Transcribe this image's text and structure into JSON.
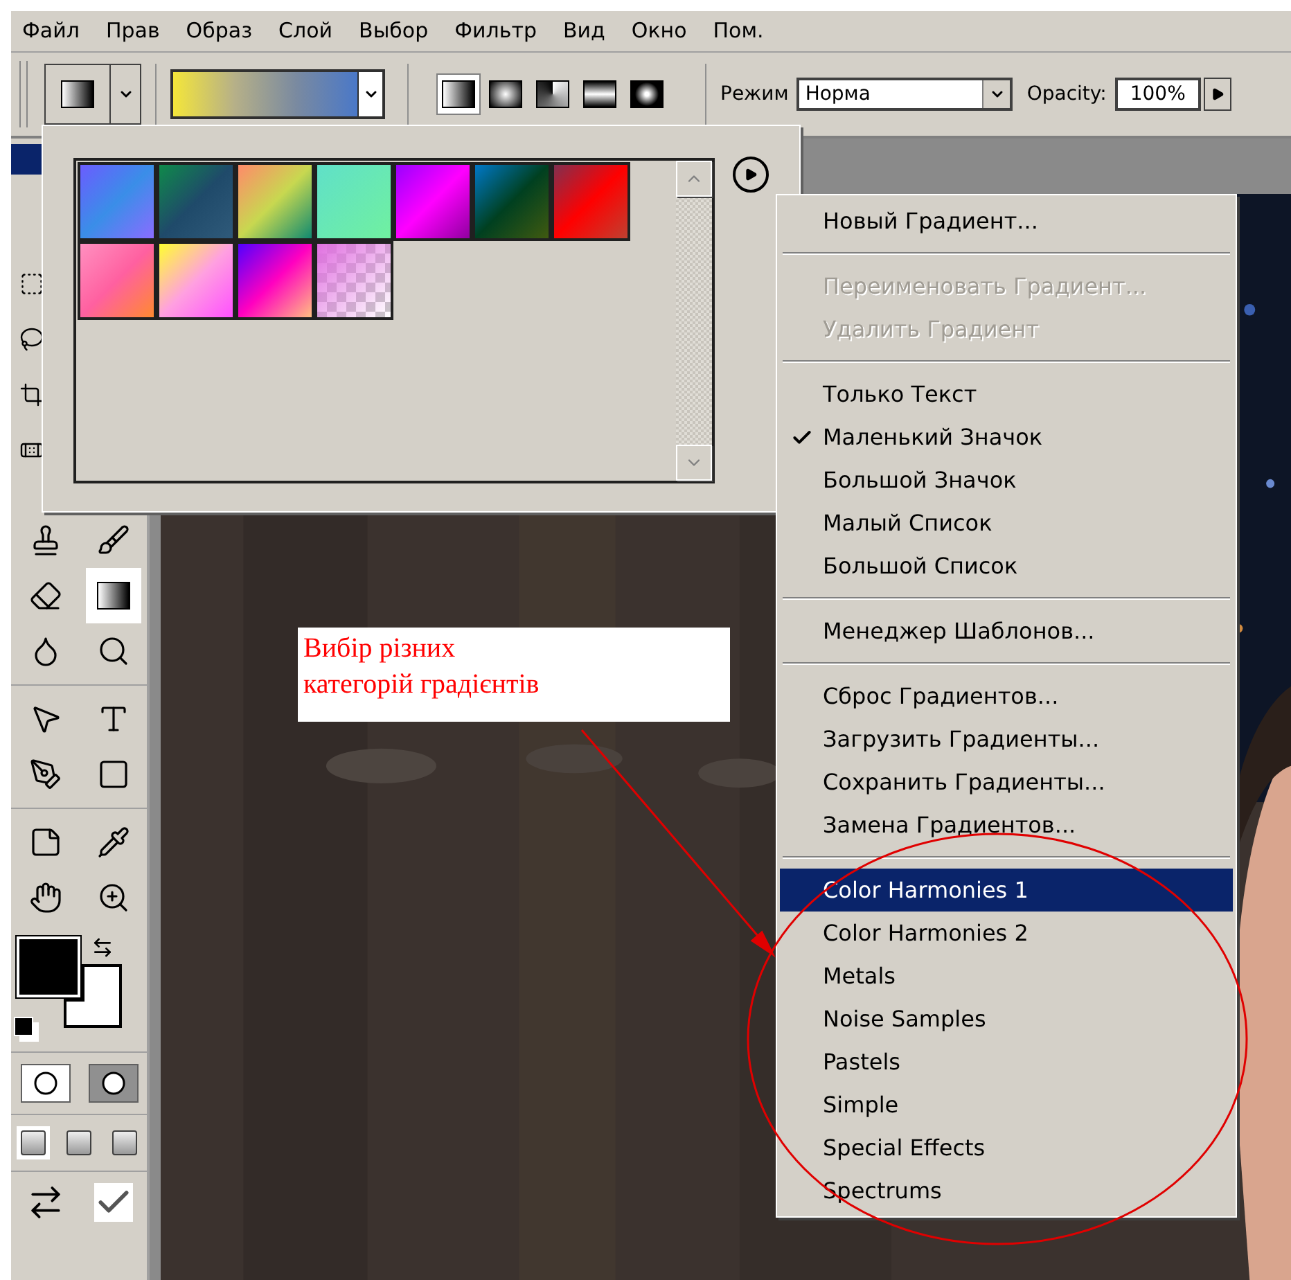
{
  "menu_bar": [
    "Файл",
    "Прав",
    "Образ",
    "Слой",
    "Выбор",
    "Фильтр",
    "Вид",
    "Окно",
    "Пом."
  ],
  "options_bar": {
    "gradient_types": [
      {
        "selected": true
      },
      {
        "selected": false
      },
      {
        "selected": false
      },
      {
        "selected": false
      },
      {
        "selected": false
      }
    ],
    "mode_label": "Режим",
    "mode_value": "Норма",
    "opacity_label": "Opacity:",
    "opacity_value": "100%"
  },
  "toolbox": {
    "tools": [
      {
        "selected": false
      },
      {
        "selected": false
      },
      {
        "selected": false
      },
      {
        "selected": true
      },
      {
        "selected": false
      },
      {
        "selected": false
      },
      {
        "selected": false
      },
      {
        "selected": false
      },
      {
        "selected": false
      },
      {
        "selected": false
      },
      {
        "selected": false
      },
      {
        "selected": false
      },
      {
        "selected": false
      },
      {
        "selected": false
      }
    ],
    "mask_modes": [
      {
        "selected": true
      },
      {
        "selected": false
      }
    ],
    "screen_modes": [
      {
        "selected": true
      },
      {
        "selected": false
      },
      {
        "selected": false
      }
    ]
  },
  "flyout_menu": {
    "items": [
      {
        "kind": "item",
        "label": "Новый Градиент...",
        "disabled": false,
        "checked": false,
        "selected": false
      },
      {
        "kind": "separator"
      },
      {
        "kind": "item",
        "label": "Переименовать Градиент...",
        "disabled": true,
        "checked": false,
        "selected": false
      },
      {
        "kind": "item",
        "label": "Удалить Градиент",
        "disabled": true,
        "checked": false,
        "selected": false
      },
      {
        "kind": "separator"
      },
      {
        "kind": "item",
        "label": "Только Текст",
        "disabled": false,
        "checked": false,
        "selected": false
      },
      {
        "kind": "item",
        "label": "Маленький Значок",
        "disabled": false,
        "checked": true,
        "selected": false
      },
      {
        "kind": "item",
        "label": "Большой Значок",
        "disabled": false,
        "checked": false,
        "selected": false
      },
      {
        "kind": "item",
        "label": "Малый Список",
        "disabled": false,
        "checked": false,
        "selected": false
      },
      {
        "kind": "item",
        "label": "Большой Список",
        "disabled": false,
        "checked": false,
        "selected": false
      },
      {
        "kind": "separator"
      },
      {
        "kind": "item",
        "label": "Менеджер Шаблонов...",
        "disabled": false,
        "checked": false,
        "selected": false
      },
      {
        "kind": "separator"
      },
      {
        "kind": "item",
        "label": "Сброс Градиентов...",
        "disabled": false,
        "checked": false,
        "selected": false
      },
      {
        "kind": "item",
        "label": "Загрузить Градиенты...",
        "disabled": false,
        "checked": false,
        "selected": false
      },
      {
        "kind": "item",
        "label": "Сохранить Градиенты...",
        "disabled": false,
        "checked": false,
        "selected": false
      },
      {
        "kind": "item",
        "label": "Замена Градиентов...",
        "disabled": false,
        "checked": false,
        "selected": false
      },
      {
        "kind": "separator"
      },
      {
        "kind": "item",
        "label": "Color Harmonies 1",
        "disabled": false,
        "checked": false,
        "selected": true
      },
      {
        "kind": "item",
        "label": "Color Harmonies 2",
        "disabled": false,
        "checked": false,
        "selected": false
      },
      {
        "kind": "item",
        "label": "Metals",
        "disabled": false,
        "checked": false,
        "selected": false
      },
      {
        "kind": "item",
        "label": "Noise Samples",
        "disabled": false,
        "checked": false,
        "selected": false
      },
      {
        "kind": "item",
        "label": "Pastels",
        "disabled": false,
        "checked": false,
        "selected": false
      },
      {
        "kind": "item",
        "label": "Simple",
        "disabled": false,
        "checked": false,
        "selected": false
      },
      {
        "kind": "item",
        "label": "Special Effects",
        "disabled": false,
        "checked": false,
        "selected": false
      },
      {
        "kind": "item",
        "label": "Spectrums",
        "disabled": false,
        "checked": false,
        "selected": false
      }
    ]
  },
  "annotation": {
    "text": "Вибір різних\nкатегорій градієнтів"
  }
}
